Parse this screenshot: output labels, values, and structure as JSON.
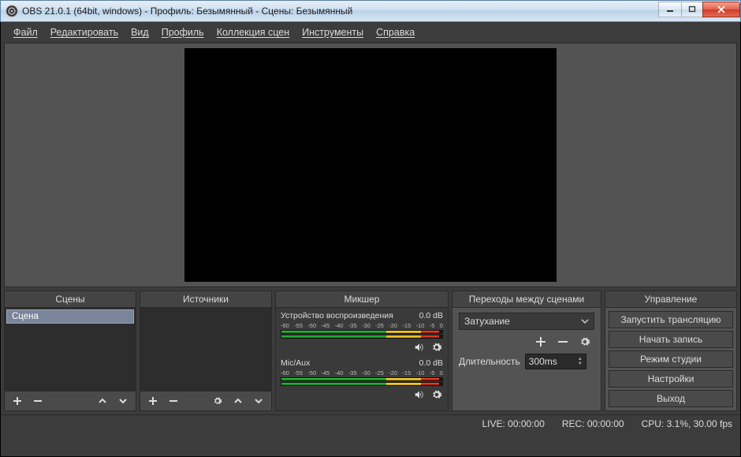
{
  "window": {
    "title": "OBS 21.0.1 (64bit, windows) - Профиль: Безымянный - Сцены: Безымянный"
  },
  "menu": [
    "Файл",
    "Редактировать",
    "Вид",
    "Профиль",
    "Коллекция сцен",
    "Инструменты",
    "Справка"
  ],
  "panels": {
    "scenes": {
      "title": "Сцены",
      "items": [
        "Сцена"
      ]
    },
    "sources": {
      "title": "Источники"
    },
    "mixer": {
      "title": "Микшер",
      "channels": [
        {
          "name": "Устройство воспроизведения",
          "db": "0.0 dB",
          "scale": [
            "-60",
            "-55",
            "-50",
            "-45",
            "-40",
            "-35",
            "-30",
            "-25",
            "-20",
            "-15",
            "-10",
            "-5",
            "0"
          ]
        },
        {
          "name": "Mic/Aux",
          "db": "0.0 dB",
          "scale": [
            "-60",
            "-55",
            "-50",
            "-45",
            "-40",
            "-35",
            "-30",
            "-25",
            "-20",
            "-15",
            "-10",
            "-5",
            "0"
          ]
        }
      ]
    },
    "transitions": {
      "title": "Переходы между сценами",
      "selected": "Затухание",
      "duration_label": "Длительность",
      "duration_value": "300ms"
    },
    "controls": {
      "title": "Управление",
      "buttons": [
        "Запустить трансляцию",
        "Начать запись",
        "Режим студии",
        "Настройки",
        "Выход"
      ]
    }
  },
  "status": {
    "live": "LIVE: 00:00:00",
    "rec": "REC: 00:00:00",
    "cpu": "CPU: 3.1%, 30.00 fps"
  }
}
